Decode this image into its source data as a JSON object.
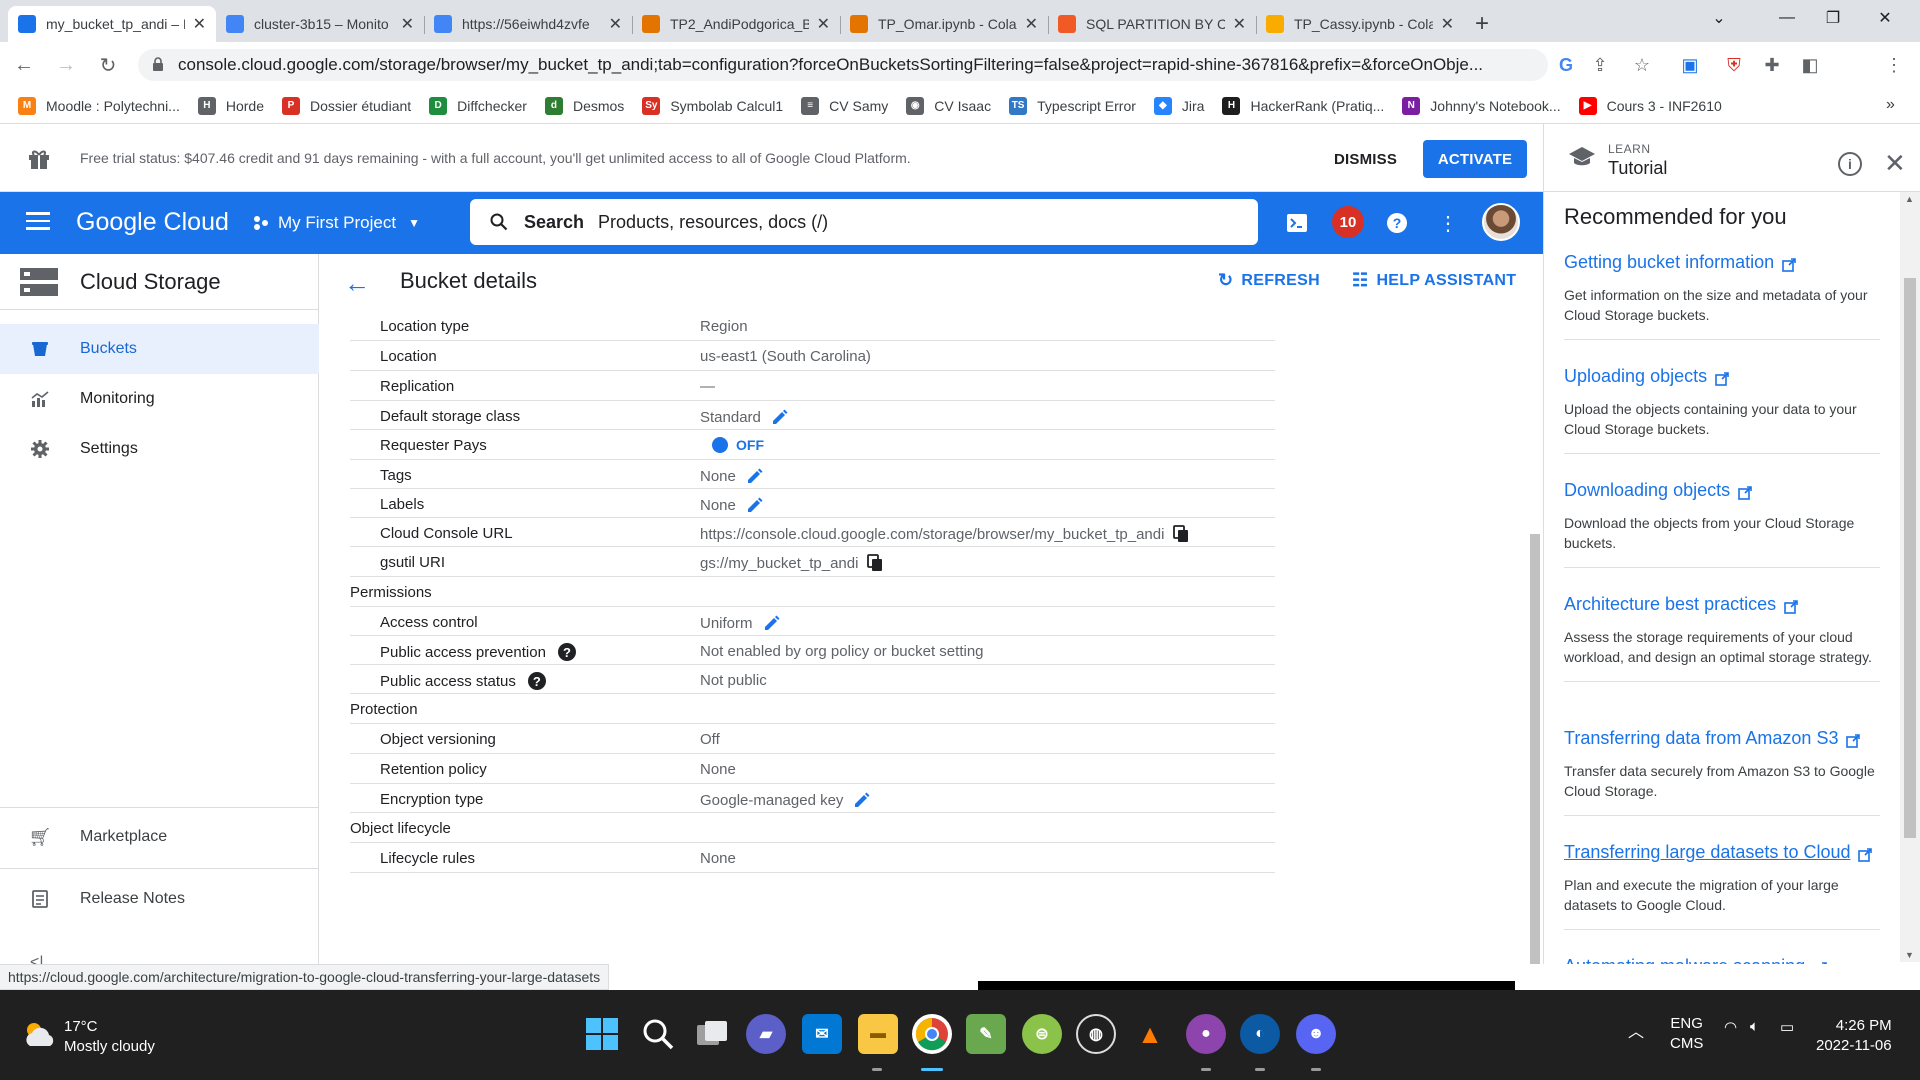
{
  "browser": {
    "tabs": [
      {
        "title": "my_bucket_tp_andi – B",
        "icon": "cloud-storage-icon",
        "color": "#1a73e8",
        "active": true
      },
      {
        "title": "cluster-3b15 – Monito",
        "icon": "dataproc-icon",
        "color": "#4285f4",
        "active": false
      },
      {
        "title": "https://56eiwhd4zvfe",
        "icon": "google-icon",
        "color": "#4285f4",
        "active": false
      },
      {
        "title": "TP2_AndiPodgorica_B",
        "icon": "colab-icon",
        "color": "#e37400",
        "active": false
      },
      {
        "title": "TP_Omar.ipynb - Cola",
        "icon": "colab-icon",
        "color": "#e37400",
        "active": false
      },
      {
        "title": "SQL PARTITION BY Cl",
        "icon": "sqlshack-icon",
        "color": "#f15a24",
        "active": false
      },
      {
        "title": "TP_Cassy.ipynb - Cola",
        "icon": "colab-icon",
        "color": "#f9ab00",
        "active": false
      }
    ],
    "url": "console.cloud.google.com/storage/browser/my_bucket_tp_andi;tab=configuration?forceOnBucketsSortingFiltering=false&project=rapid-shine-367816&prefix=&forceOnObje...",
    "bookmarks": [
      {
        "label": "Moodle : Polytechni...",
        "color": "#f98012",
        "glyph": "M"
      },
      {
        "label": "Horde",
        "color": "#5f6368",
        "glyph": "H"
      },
      {
        "label": "Dossier étudiant",
        "color": "#d93025",
        "glyph": "P"
      },
      {
        "label": "Diffchecker",
        "color": "#1e8e3e",
        "glyph": "D"
      },
      {
        "label": "Desmos",
        "color": "#2e7d32",
        "glyph": "d"
      },
      {
        "label": "Symbolab Calcul1",
        "color": "#d93025",
        "glyph": "Sy"
      },
      {
        "label": "CV Samy",
        "color": "#5f6368",
        "glyph": "≡"
      },
      {
        "label": "CV Isaac",
        "color": "#5f6368",
        "glyph": "◉"
      },
      {
        "label": "Typescript Error",
        "color": "#3178c6",
        "glyph": "TS"
      },
      {
        "label": "Jira",
        "color": "#2684ff",
        "glyph": "◆"
      },
      {
        "label": "HackerRank (Pratiq...",
        "color": "#1e1e1e",
        "glyph": "H"
      },
      {
        "label": "Johnny's Notebook...",
        "color": "#7b1fa2",
        "glyph": "N"
      },
      {
        "label": "Cours 3 - INF2610",
        "color": "#ff0000",
        "glyph": "▶"
      }
    ]
  },
  "banner": {
    "text": "Free trial status: $407.46 credit and 91 days remaining - with a full account, you'll get unlimited access to all of Google Cloud Platform.",
    "dismiss": "DISMISS",
    "activate": "ACTIVATE"
  },
  "topbar": {
    "logo": "Google Cloud",
    "project": "My First Project",
    "search_label": "Search",
    "search_hint": "Products, resources, docs (/)",
    "notifications": "10"
  },
  "leftnav": {
    "title": "Cloud Storage",
    "items": [
      {
        "label": "Buckets",
        "active": true
      },
      {
        "label": "Monitoring",
        "active": false
      },
      {
        "label": "Settings",
        "active": false
      }
    ],
    "bottom": [
      {
        "label": "Marketplace"
      },
      {
        "label": "Release Notes"
      }
    ],
    "collapse": "<|"
  },
  "page": {
    "title": "Bucket details",
    "refresh": "REFRESH",
    "help": "HELP ASSISTANT",
    "rows": [
      {
        "key": "Location type",
        "value": "Region"
      },
      {
        "key": "Location",
        "value": "us-east1 (South Carolina)"
      },
      {
        "key": "Replication",
        "value": "—"
      },
      {
        "key": "Default storage class",
        "value": "Standard",
        "edit": true
      },
      {
        "key": "Requester Pays",
        "value": "OFF"
      },
      {
        "key": "Tags",
        "value": "None",
        "edit": true
      },
      {
        "key": "Labels",
        "value": "None",
        "edit": true
      },
      {
        "key": "Cloud Console URL",
        "value": "https://console.cloud.google.com/storage/browser/my_bucket_tp_andi",
        "copy": true
      },
      {
        "key": "gsutil URI",
        "value": "gs://my_bucket_tp_andi",
        "copy": true
      },
      {
        "section": "Permissions"
      },
      {
        "key": "Access control",
        "value": "Uniform",
        "edit": true
      },
      {
        "key": "Public access prevention",
        "value": "Not enabled by org policy or bucket setting",
        "help": true
      },
      {
        "key": "Public access status",
        "value": "Not public",
        "help": true
      },
      {
        "section": "Protection"
      },
      {
        "key": "Object versioning",
        "value": "Off"
      },
      {
        "key": "Retention policy",
        "value": "None"
      },
      {
        "key": "Encryption type",
        "value": "Google-managed key",
        "edit": true
      },
      {
        "section": "Object lifecycle"
      },
      {
        "key": "Lifecycle rules",
        "value": "None"
      }
    ]
  },
  "tutorial": {
    "learn": "LEARN",
    "title": "Tutorial",
    "recommended": "Recommended for you",
    "resources": [
      {
        "title": "Getting bucket information",
        "desc": "Get information on the size and metadata of your Cloud Storage buckets."
      },
      {
        "title": "Uploading objects",
        "desc": "Upload the objects containing your data to your Cloud Storage buckets."
      },
      {
        "title": "Downloading objects",
        "desc": "Download the objects from your Cloud Storage buckets."
      },
      {
        "title": "Architecture best practices",
        "desc": "Assess the storage requirements of your cloud workload, and design an optimal storage strategy."
      },
      {
        "title": "Transferring data from Amazon S3",
        "desc": "Transfer data securely from Amazon S3 to Google Cloud Storage."
      },
      {
        "title": "Transferring large datasets to Cloud",
        "desc": "Plan and execute the migration of your large datasets to Google Cloud."
      },
      {
        "title": "Automating malware scanning",
        "desc": ""
      }
    ]
  },
  "status_url": "https://cloud.google.com/architecture/migration-to-google-cloud-transferring-your-large-datasets",
  "taskbar": {
    "temp": "17°C",
    "weather": "Mostly cloudy",
    "lang": "ENG",
    "ime": "CMS",
    "time": "4:26 PM",
    "date": "2022-11-06"
  },
  "colors": {
    "accent": "#1a73e8",
    "alert": "#d93025",
    "nav_active_bg": "#e8f0fe"
  }
}
